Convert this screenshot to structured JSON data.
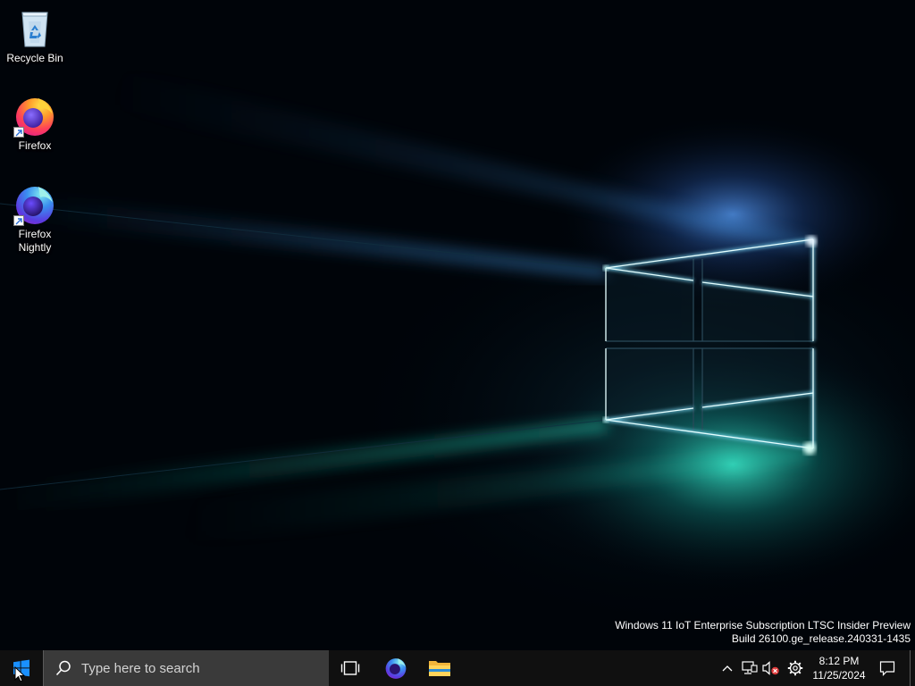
{
  "desktop": {
    "icons": [
      {
        "label": "Recycle Bin",
        "icon": "recycle-bin-icon"
      },
      {
        "label": "Firefox",
        "icon": "firefox-icon",
        "shortcut": true
      },
      {
        "label": "Firefox\nNightly",
        "icon": "firefox-nightly-icon",
        "shortcut": true
      }
    ],
    "watermark": {
      "line1": "Windows 11 IoT Enterprise Subscription LTSC Insider Preview",
      "line2": "Build 26100.ge_release.240331-1435"
    }
  },
  "taskbar": {
    "start_icon": "windows-logo-icon",
    "search_placeholder": "Type here to search",
    "pinned": [
      {
        "icon": "task-view-icon"
      },
      {
        "icon": "firefox-nightly-icon"
      },
      {
        "icon": "file-explorer-icon"
      }
    ],
    "tray": {
      "icons": [
        "chevron-up-icon",
        "network-icon",
        "volume-muted-icon",
        "gear-icon"
      ],
      "time": "8:12 PM",
      "date": "11/25/2024",
      "notification_icon": "notification-icon"
    }
  },
  "colors": {
    "taskbar_bg": "#101010",
    "search_bg": "#3a3a3a",
    "accent_blue": "#0078d7",
    "light_cyan": "#c8ffff"
  }
}
